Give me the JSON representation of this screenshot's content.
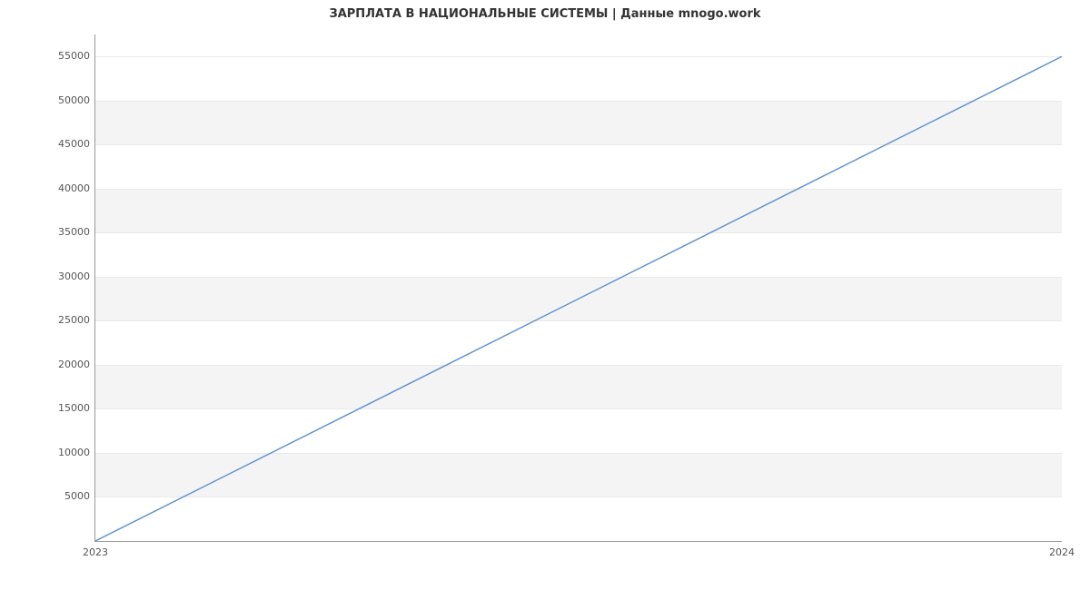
{
  "chart_data": {
    "type": "line",
    "title": "ЗАРПЛАТА В НАЦИОНАЛЬНЫЕ СИСТЕМЫ | Данные mnogo.work",
    "xlabel": "",
    "ylabel": "",
    "x": [
      2023,
      2024
    ],
    "values": [
      0,
      55000
    ],
    "ylim": [
      0,
      57500
    ],
    "yticks": [
      5000,
      10000,
      15000,
      20000,
      25000,
      30000,
      35000,
      40000,
      45000,
      50000,
      55000
    ],
    "xticks": [
      2023,
      2024
    ],
    "bands": true,
    "line_color": "#5a8fd6"
  }
}
